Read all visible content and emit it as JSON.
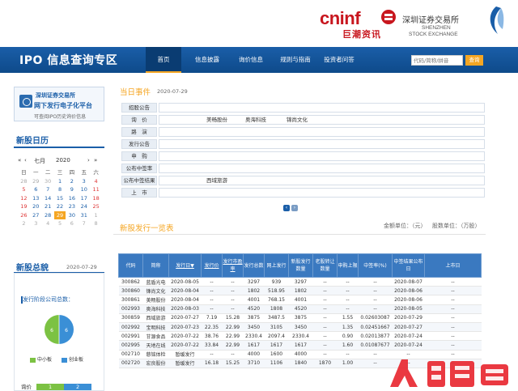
{
  "header": {
    "brand_en": "cninf",
    "brand_cn": "巨潮资讯",
    "szse_cn": "深圳证券交易所",
    "szse_en_1": "SHENZHEN",
    "szse_en_2": "STOCK EXCHANGE"
  },
  "nav": {
    "site_title": "IPO 信息查询专区",
    "items": [
      "首页",
      "信息披露",
      "询价信息",
      "规则与指南",
      "投资者问答"
    ],
    "search_placeholder": "代码/简称/拼音",
    "search_button": "查询"
  },
  "promo": {
    "line1": "深圳证券交易所",
    "line2": "网下发行电子化平台",
    "line3": "可查阅IPO历史询价信息"
  },
  "calendar": {
    "title": "新股日历",
    "prev_year": "«",
    "prev_month": "‹",
    "month": "七月",
    "year": "2020",
    "next_month": "›",
    "next_year": "»",
    "weekday_headers": [
      "日",
      "一",
      "二",
      "三",
      "四",
      "五",
      "六"
    ],
    "weeks": [
      [
        "28",
        "29",
        "30",
        "1",
        "2",
        "3",
        "4"
      ],
      [
        "5",
        "6",
        "7",
        "8",
        "9",
        "10",
        "11"
      ],
      [
        "12",
        "13",
        "14",
        "15",
        "16",
        "17",
        "18"
      ],
      [
        "19",
        "20",
        "21",
        "22",
        "23",
        "24",
        "25"
      ],
      [
        "26",
        "27",
        "28",
        "29",
        "30",
        "31",
        "1"
      ],
      [
        "2",
        "3",
        "4",
        "5",
        "6",
        "7",
        "8"
      ]
    ]
  },
  "overview": {
    "title": "新股总貌",
    "date": "2020-07-29",
    "label": "发行阶段公司总数：",
    "pie_left": "6",
    "pie_right": "6",
    "legend": [
      "中小板",
      "创业板"
    ],
    "bottom_label": "询价",
    "bottom_values": [
      "1",
      "2"
    ],
    "colors": {
      "sme": "#7cc243",
      "gem": "#3a8fd6"
    }
  },
  "events": {
    "title": "当日事件",
    "date": "2020-07-29",
    "rows": [
      {
        "label": "招股公告",
        "items": []
      },
      {
        "label": "询　价",
        "items": [
          "美畅股份",
          "奥海科技",
          "锦尚文化"
        ]
      },
      {
        "label": "路　演",
        "items": []
      },
      {
        "label": "发行公告",
        "items": []
      },
      {
        "label": "申　购",
        "items": []
      },
      {
        "label": "公布中签率",
        "items": []
      },
      {
        "label": "公布中签结果",
        "items": [
          "西域旅游"
        ]
      },
      {
        "label": "上　市",
        "items": []
      }
    ]
  },
  "ipo_list": {
    "title": "新股发行一览表",
    "unit_amount": "金额单位：（元）",
    "unit_shares": "股数单位：（万股）",
    "columns": [
      "代码",
      "简称",
      "发行日▼",
      "发行价",
      "发行市盈率",
      "发行总数",
      "网上发行",
      "新股发行数量",
      "老股转让数量",
      "申购上限",
      "中签率(%)",
      "中签结果公布日",
      "上市日"
    ],
    "rows": [
      [
        "300862",
        "蓝盾光电",
        "2020-08-05",
        "--",
        "--",
        "3297",
        "939",
        "3297",
        "--",
        "--",
        "--",
        "2020-08-07",
        "--"
      ],
      [
        "300860",
        "锋尚文化",
        "2020-08-04",
        "--",
        "--",
        "1802",
        "518.95",
        "1802",
        "--",
        "--",
        "--",
        "2020-08-06",
        "--"
      ],
      [
        "300861",
        "美畅股份",
        "2020-08-04",
        "--",
        "--",
        "4001",
        "768.15",
        "4001",
        "--",
        "--",
        "--",
        "2020-08-06",
        "--"
      ],
      [
        "002993",
        "奥海科技",
        "2020-08-03",
        "--",
        "--",
        "4520",
        "1808",
        "4520",
        "--",
        "--",
        "--",
        "2020-08-05",
        "--"
      ],
      [
        "300859",
        "西域旅游",
        "2020-07-27",
        "7.19",
        "15.28",
        "3875",
        "3487.5",
        "3875",
        "--",
        "1.55",
        "0.02603087",
        "2020-07-29",
        "--"
      ],
      [
        "002992",
        "宝明科技",
        "2020-07-23",
        "22.35",
        "22.99",
        "3450",
        "3105",
        "3450",
        "--",
        "1.35",
        "0.02451667",
        "2020-07-27",
        "--"
      ],
      [
        "002991",
        "甘源食品",
        "2020-07-22",
        "38.76",
        "22.99",
        "2330.4",
        "2097.4",
        "2330.4",
        "--",
        "0.90",
        "0.02013877",
        "2020-07-24",
        "--"
      ],
      [
        "002995",
        "天地在线",
        "2020-07-22",
        "33.84",
        "22.99",
        "1617",
        "1617",
        "1617",
        "--",
        "1.60",
        "0.01087677",
        "2020-07-24",
        "--"
      ],
      [
        "002710",
        "慈铭体检",
        "暂缓发行",
        "--",
        "--",
        "4000",
        "1600",
        "4000",
        "--",
        "--",
        "--",
        "--",
        "--"
      ],
      [
        "002720",
        "宏良股份",
        "暂缓发行",
        "16.18",
        "15.25",
        "3710",
        "1106",
        "1840",
        "1870",
        "1.00",
        "--",
        "--",
        "--"
      ]
    ]
  }
}
